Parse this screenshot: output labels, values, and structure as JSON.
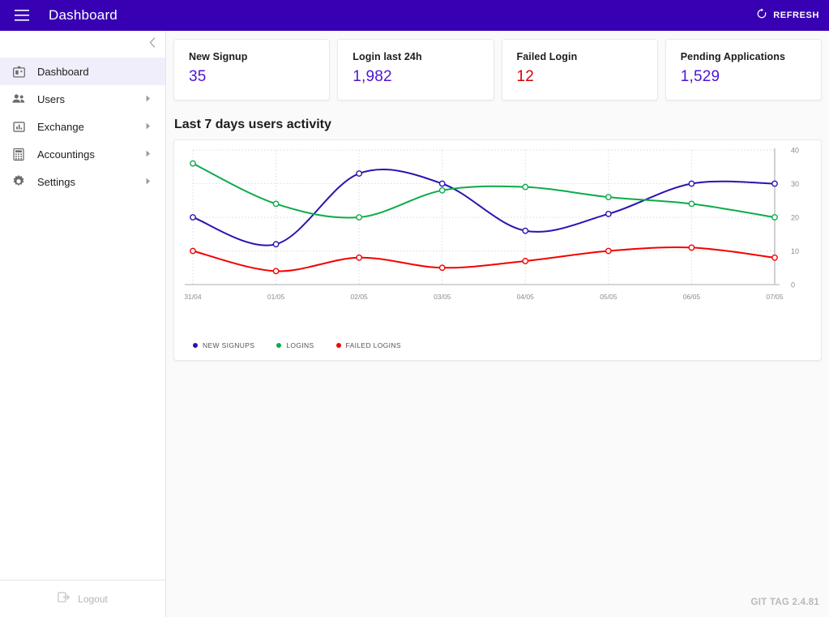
{
  "appbar": {
    "menu_icon": "hamburger-menu-icon",
    "title": "Dashboard",
    "refresh_icon": "refresh-icon",
    "refresh_label": "REFRESH",
    "background": "#3700b3"
  },
  "sidebar": {
    "collapse_icon": "chevron-left-icon",
    "items": [
      {
        "label": "Dashboard",
        "icon": "dashboard-icon",
        "active": true,
        "has_submenu": false
      },
      {
        "label": "Users",
        "icon": "users-icon",
        "active": false,
        "has_submenu": true
      },
      {
        "label": "Exchange",
        "icon": "chart-bar-icon",
        "active": false,
        "has_submenu": true
      },
      {
        "label": "Accountings",
        "icon": "calculator-icon",
        "active": false,
        "has_submenu": true
      },
      {
        "label": "Settings",
        "icon": "gear-icon",
        "active": false,
        "has_submenu": true
      }
    ],
    "footer": {
      "label": "Logout",
      "icon": "logout-icon"
    }
  },
  "stats": [
    {
      "title": "New Signup",
      "value": "35",
      "color": "#4a16d0"
    },
    {
      "title": "Login last 24h",
      "value": "1,982",
      "color": "#4a16d0"
    },
    {
      "title": "Failed Login",
      "value": "12",
      "color": "#d50000"
    },
    {
      "title": "Pending Applications",
      "value": "1,529",
      "color": "#4a16d0"
    }
  ],
  "section": {
    "title": "Last 7 days users activity"
  },
  "footer": {
    "git_tag": "GIT TAG 2.4.81"
  },
  "chart_data": {
    "type": "line",
    "title": "Last 7 days users activity",
    "xlabel": "",
    "ylabel": "",
    "x": [
      "31/04",
      "01/05",
      "02/05",
      "03/05",
      "04/05",
      "05/05",
      "06/05",
      "07/05"
    ],
    "ylim": [
      0,
      40
    ],
    "yticks": [
      0,
      10,
      20,
      30,
      40
    ],
    "grid": true,
    "y_axis_position": "right",
    "legend_position": "bottom-left",
    "series": [
      {
        "name": "NEW SIGNUPS",
        "color": "#2c13b0",
        "values": [
          20,
          12,
          33,
          30,
          16,
          21,
          30,
          30
        ]
      },
      {
        "name": "LOGINS",
        "color": "#0cab4a",
        "values": [
          36,
          24,
          20,
          28,
          29,
          26,
          24,
          20
        ]
      },
      {
        "name": "FAILED LOGINS",
        "color": "#f40000",
        "values": [
          10,
          4,
          8,
          5,
          7,
          10,
          11,
          8
        ]
      }
    ]
  }
}
